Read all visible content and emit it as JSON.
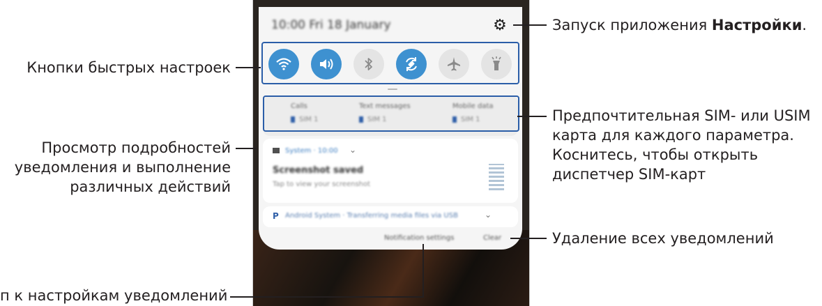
{
  "panel": {
    "status_text": "10:00  Fri 18 January",
    "settings_icon": "gear-icon",
    "quick_settings": [
      {
        "name": "wifi",
        "icon": "wifi-icon",
        "state": "on",
        "glyph": "◠"
      },
      {
        "name": "sound",
        "icon": "sound-icon",
        "state": "on",
        "glyph": "◀)"
      },
      {
        "name": "bluetooth",
        "icon": "bluetooth-icon",
        "state": "off",
        "glyph": "✱"
      },
      {
        "name": "auto-rotate",
        "icon": "rotate-icon",
        "state": "on",
        "glyph": "⟲"
      },
      {
        "name": "airplane",
        "icon": "airplane-icon",
        "state": "off",
        "glyph": "✈"
      },
      {
        "name": "flashlight",
        "icon": "flashlight-icon",
        "state": "off",
        "glyph": "♨"
      }
    ],
    "sim_prefs": [
      {
        "label": "Calls",
        "value": "SIM 1"
      },
      {
        "label": "Text messages",
        "value": "SIM 1"
      },
      {
        "label": "Mobile data",
        "value": "SIM 1"
      }
    ],
    "notification": {
      "app": "System · 10:00",
      "title": "Screenshot saved",
      "body": "Tap to view your screenshot"
    },
    "notification2": {
      "text": "Android System · Transferring media files via USB"
    },
    "buttons": {
      "settings": "Notification settings",
      "clear": "Clear"
    }
  },
  "callouts": {
    "settings": "Запуск приложения ",
    "settings_bold": "Настройки",
    "settings_end": ".",
    "quick": "Кнопки быстрых настроек",
    "sim_1": "Предпочтительная SIM- или USIM",
    "sim_2": "карта для каждого параметра.",
    "sim_3": "Коснитесь, чтобы открыть",
    "sim_4": "диспетчер SIM-карт",
    "detail_1": "Просмотр подробностей",
    "detail_2": "уведомления и выполнение",
    "detail_3": "различных действий",
    "clear": "Удаление всех уведомлений",
    "notif_settings": "п к настройкам уведомлений"
  }
}
